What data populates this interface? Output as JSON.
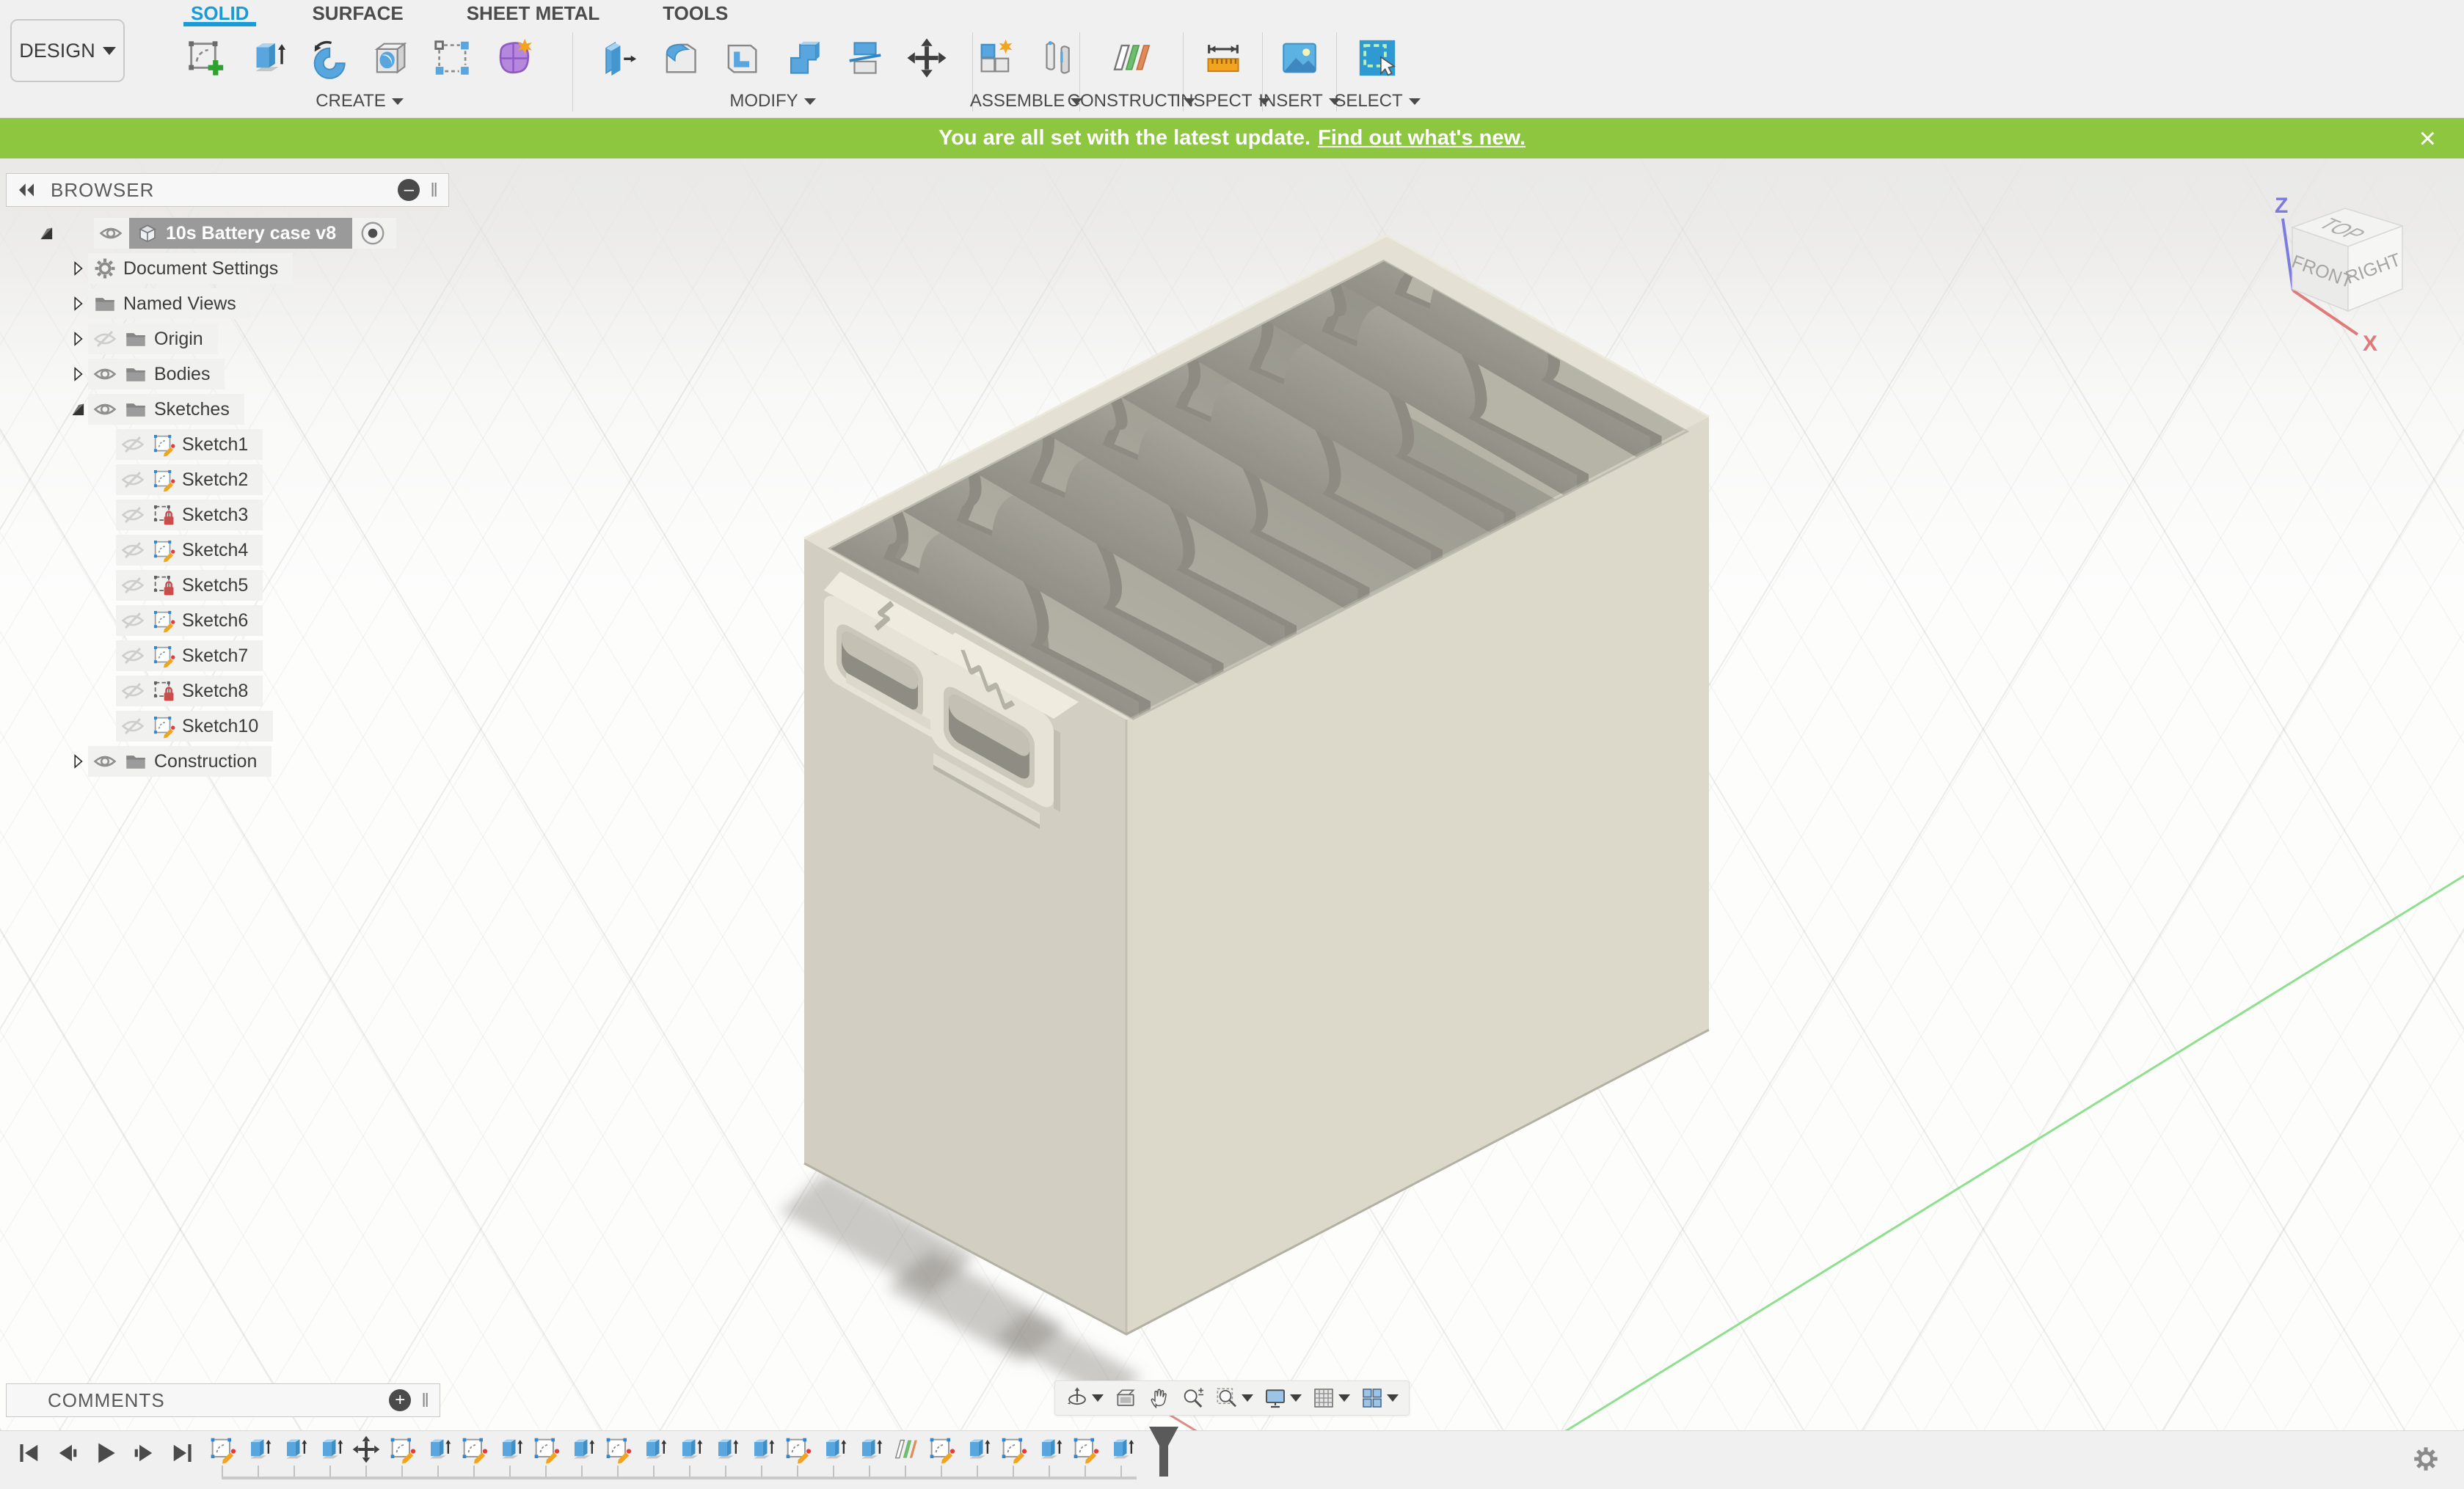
{
  "app": {
    "menu_label": "DESIGN"
  },
  "tabs": [
    {
      "label": "SOLID",
      "active": true
    },
    {
      "label": "SURFACE",
      "active": false
    },
    {
      "label": "SHEET METAL",
      "active": false
    },
    {
      "label": "TOOLS",
      "active": false
    }
  ],
  "toolbar_groups": [
    {
      "label": "CREATE",
      "icons": [
        "create-sketch",
        "extrude",
        "revolve",
        "hole",
        "rectangular-pattern",
        "create-form"
      ]
    },
    {
      "label": "MODIFY",
      "icons": [
        "press-pull",
        "fillet",
        "shell",
        "combine",
        "split-body",
        "move"
      ]
    },
    {
      "label": "ASSEMBLE",
      "icons": [
        "new-component",
        "joint"
      ]
    },
    {
      "label": "CONSTRUCT",
      "icons": [
        "construct-plane"
      ]
    },
    {
      "label": "INSPECT",
      "icons": [
        "measure"
      ]
    },
    {
      "label": "INSERT",
      "icons": [
        "insert-image"
      ]
    },
    {
      "label": "SELECT",
      "icons": [
        "select"
      ]
    }
  ],
  "banner": {
    "message": "You are all set with the latest update.",
    "link_text": "Find out what's new.",
    "close": "×"
  },
  "browser": {
    "title": "BROWSER",
    "items": [
      {
        "label": "10s Battery case v8",
        "level": 1,
        "expand": "expanded",
        "eye": "visible",
        "icon": "cube",
        "selected": true,
        "radio": true
      },
      {
        "label": "Document Settings",
        "level": 2,
        "expand": "collapsed",
        "eye": null,
        "icon": "gear"
      },
      {
        "label": "Named Views",
        "level": 2,
        "expand": "collapsed",
        "eye": null,
        "icon": "folder"
      },
      {
        "label": "Origin",
        "level": 2,
        "expand": "collapsed",
        "eye": "hidden",
        "icon": "folder"
      },
      {
        "label": "Bodies",
        "level": 2,
        "expand": "collapsed",
        "eye": "visible",
        "icon": "folder"
      },
      {
        "label": "Sketches",
        "level": 2,
        "expand": "expanded",
        "eye": "visible",
        "icon": "folder"
      },
      {
        "label": "Sketch1",
        "level": 3,
        "eye": "hidden",
        "icon": "sketch-pencil"
      },
      {
        "label": "Sketch2",
        "level": 3,
        "eye": "hidden",
        "icon": "sketch-pencil"
      },
      {
        "label": "Sketch3",
        "level": 3,
        "eye": "hidden",
        "icon": "sketch-lock"
      },
      {
        "label": "Sketch4",
        "level": 3,
        "eye": "hidden",
        "icon": "sketch-pencil"
      },
      {
        "label": "Sketch5",
        "level": 3,
        "eye": "hidden",
        "icon": "sketch-lock"
      },
      {
        "label": "Sketch6",
        "level": 3,
        "eye": "hidden",
        "icon": "sketch-pencil"
      },
      {
        "label": "Sketch7",
        "level": 3,
        "eye": "hidden",
        "icon": "sketch-pencil"
      },
      {
        "label": "Sketch8",
        "level": 3,
        "eye": "hidden",
        "icon": "sketch-lock"
      },
      {
        "label": "Sketch10",
        "level": 3,
        "eye": "hidden",
        "icon": "sketch-pencil"
      },
      {
        "label": "Construction",
        "level": 2,
        "expand": "collapsed",
        "eye": "visible",
        "icon": "folder"
      }
    ]
  },
  "viewcube": {
    "faces": [
      "TOP",
      "FRONT",
      "RIGHT"
    ],
    "axis_labels": [
      "Z",
      "X"
    ]
  },
  "comments": {
    "title": "COMMENTS"
  },
  "nav_toolbar": {
    "items": [
      {
        "name": "orbit",
        "caret": true
      },
      {
        "name": "look-at",
        "caret": false
      },
      {
        "name": "pan",
        "caret": false
      },
      {
        "name": "zoom",
        "caret": false
      },
      {
        "name": "zoom-window",
        "caret": true
      },
      {
        "name": "display-settings",
        "caret": true
      },
      {
        "name": "grid-display",
        "caret": true
      },
      {
        "name": "viewports",
        "caret": true
      }
    ]
  },
  "timeline": {
    "playback": [
      "go-to-start",
      "step-back",
      "play",
      "step-forward",
      "go-to-end"
    ],
    "features": [
      "sketch",
      "extrude",
      "extrude",
      "extrude",
      "move",
      "sketch",
      "extrude",
      "sketch",
      "extrude",
      "sketch",
      "extrude",
      "sketch",
      "extrude",
      "extrude",
      "extrude",
      "extrude",
      "sketch",
      "extrude",
      "extrude",
      "plane",
      "sketch",
      "extrude",
      "sketch",
      "extrude",
      "sketch",
      "extrude"
    ]
  },
  "colors": {
    "accent_blue": "#189bd7",
    "banner_green": "#8dc63f",
    "selection_gray": "#9a9a9a",
    "case_beige": "#d8d5c7",
    "icon_blue": "#58a6dd",
    "icon_purple": "#b588dd",
    "icon_orange": "#f2a41f",
    "construct_green": "#6fbe6f",
    "construct_orange": "#e08b5a",
    "axis_green": "#8ee08e",
    "axis_red": "#e08a8a",
    "viewcube_z_blue": "#7b7be0",
    "viewcube_x_red": "#e07a7a"
  }
}
